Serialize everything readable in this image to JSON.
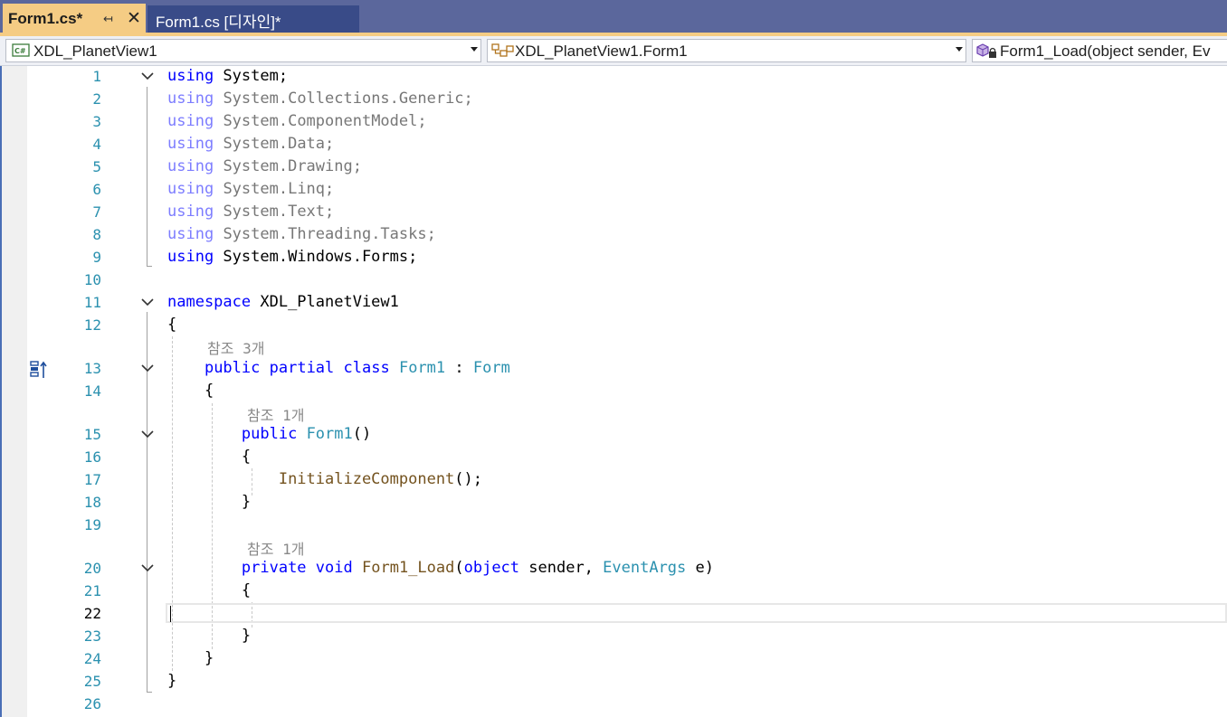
{
  "tabs": [
    {
      "label": "Form1.cs*",
      "active": true
    },
    {
      "label": "Form1.cs [디자인]*",
      "active": false
    }
  ],
  "navigation": {
    "project": "XDL_PlanetView1",
    "type": "XDL_PlanetView1.Form1",
    "member": "Form1_Load(object sender, Ev"
  },
  "icons": {
    "project": "csharp-project-icon",
    "type": "class-icon",
    "member": "private-method-icon",
    "gutter": "navigate-to-base-icon"
  },
  "colors": {
    "keyword": "#0000ff",
    "type": "#2b91af",
    "method": "#74531f",
    "line_number": "#2b91af",
    "tab_active": "#f5cc84",
    "tab_bar": "#5b679c"
  },
  "editor": {
    "current_line": 22,
    "references": [
      "참조 3개",
      "참조 1개",
      "참조 1개"
    ],
    "lines": [
      {
        "n": 1,
        "code": "using System;"
      },
      {
        "n": 2,
        "code": "using System.Collections.Generic;"
      },
      {
        "n": 3,
        "code": "using System.ComponentModel;"
      },
      {
        "n": 4,
        "code": "using System.Data;"
      },
      {
        "n": 5,
        "code": "using System.Drawing;"
      },
      {
        "n": 6,
        "code": "using System.Linq;"
      },
      {
        "n": 7,
        "code": "using System.Text;"
      },
      {
        "n": 8,
        "code": "using System.Threading.Tasks;"
      },
      {
        "n": 9,
        "code": "using System.Windows.Forms;"
      },
      {
        "n": 10,
        "code": ""
      },
      {
        "n": 11,
        "code": "namespace XDL_PlanetView1"
      },
      {
        "n": 12,
        "code": "{"
      },
      {
        "n": 13,
        "code": "    public partial class Form1 : Form"
      },
      {
        "n": 14,
        "code": "    {"
      },
      {
        "n": 15,
        "code": "        public Form1()"
      },
      {
        "n": 16,
        "code": "        {"
      },
      {
        "n": 17,
        "code": "            InitializeComponent();"
      },
      {
        "n": 18,
        "code": "        }"
      },
      {
        "n": 19,
        "code": ""
      },
      {
        "n": 20,
        "code": "        private void Form1_Load(object sender, EventArgs e)"
      },
      {
        "n": 21,
        "code": "        {"
      },
      {
        "n": 22,
        "code": ""
      },
      {
        "n": 23,
        "code": "        }"
      },
      {
        "n": 24,
        "code": "    }"
      },
      {
        "n": 25,
        "code": "}"
      },
      {
        "n": 26,
        "code": ""
      }
    ]
  }
}
